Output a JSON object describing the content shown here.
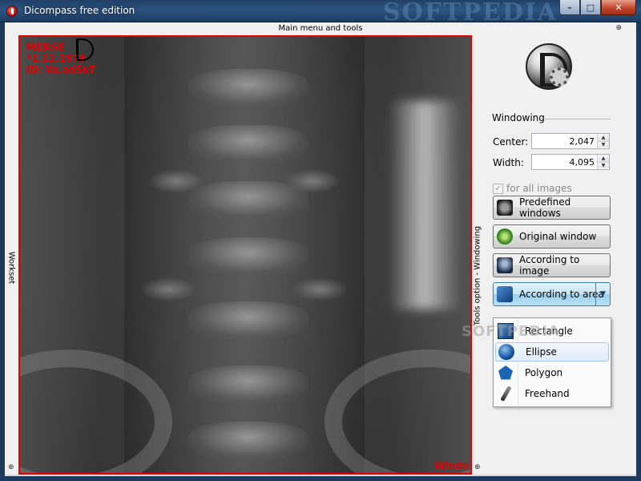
{
  "window": {
    "title": "Dicompass free edition",
    "watermark": "SOFTPEDIA",
    "buttons": {
      "minimize": "–",
      "maximize": "□",
      "close": "✕"
    }
  },
  "strips": {
    "top": "Main menu and tools",
    "left": "Workset",
    "right": "Tools option - Windowing",
    "pin_glyph": "⊕"
  },
  "viewer": {
    "overlay_lines": [
      "MERGE",
      "*1.12.1979",
      "ID: Va.adSkT"
    ],
    "corner_label": "Windo",
    "border_color": "#e80000"
  },
  "windowing": {
    "section_title": "Windowing",
    "center_label": "Center:",
    "center_value": "2,047",
    "width_label": "Width:",
    "width_value": "4,095",
    "all_images_label": "for all images",
    "all_images_checked": true,
    "all_images_enabled": false
  },
  "buttons": {
    "predefined": "Predefined windows",
    "original": "Original window",
    "according_image": "According to image",
    "according_area": "According to area"
  },
  "area_menu": {
    "items": [
      {
        "label": "Rectangle",
        "icon": "rectangle-icon"
      },
      {
        "label": "Ellipse",
        "icon": "ellipse-icon",
        "hovered": true
      },
      {
        "label": "Polygon",
        "icon": "polygon-icon"
      },
      {
        "label": "Freehand",
        "icon": "freehand-icon"
      }
    ]
  },
  "overlay_watermark": "SOFTPEDIA"
}
